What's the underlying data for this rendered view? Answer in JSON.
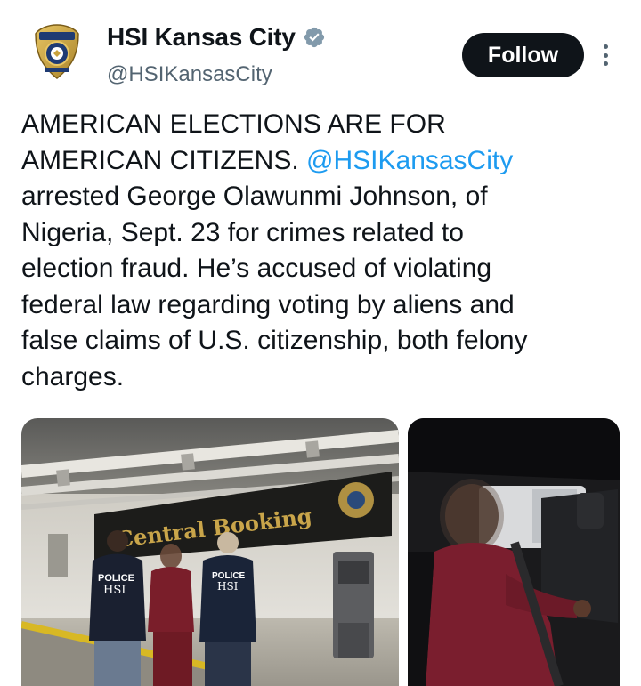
{
  "account": {
    "display_name": "HSI Kansas City",
    "handle": "@HSIKansasCity",
    "avatar_icon": "hsi-badge-icon",
    "verified_icon": "verified-badge-icon"
  },
  "actions": {
    "follow_label": "Follow",
    "more_icon": "more-options-icon"
  },
  "tweet": {
    "lines": [
      "AMERICAN ELECTIONS ARE FOR",
      "AMERICAN CITIZENS. ",
      "arrested George Olawunmi Johnson, of",
      "Nigeria, Sept. 23 for crimes related to",
      "election fraud. He’s accused of violating",
      "federal law regarding voting by aliens and",
      "false claims of U.S. citizenship, both felony",
      "charges."
    ],
    "mention": "@HSIKansasCity"
  },
  "media": {
    "photo1": {
      "sign_text": "Central Booking",
      "vest_left_line1": "POLICE",
      "vest_left_line2": "HSI",
      "vest_right_line1": "POLICE",
      "vest_right_line2": "HSI"
    },
    "photo2": {}
  },
  "colors": {
    "text": "#0f1419",
    "secondary": "#536471",
    "link": "#1d9bf0",
    "follow_bg": "#0f1419",
    "verified_gray": "#829aab"
  }
}
